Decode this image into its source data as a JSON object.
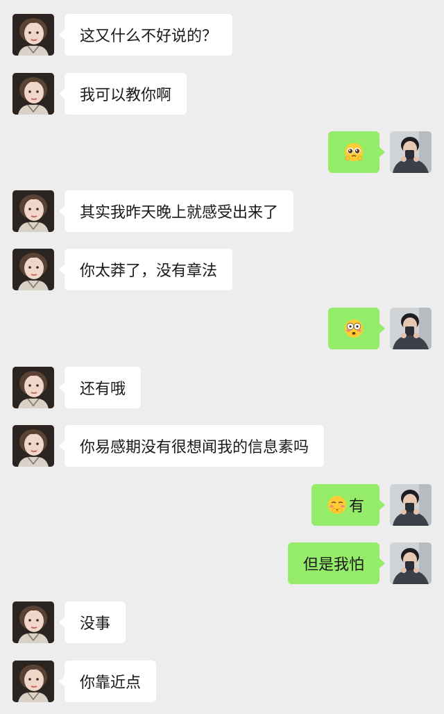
{
  "chat": {
    "colors": {
      "background": "#ededed",
      "incoming_bubble": "#ffffff",
      "outgoing_bubble": "#95ec69",
      "text": "#191919"
    },
    "messages": [
      {
        "side": "left",
        "text": "这又什么不好说的？",
        "avatar": "girl-avatar"
      },
      {
        "side": "left",
        "text": "我可以教你啊",
        "avatar": "girl-avatar"
      },
      {
        "side": "right",
        "text": "",
        "emoji": "pleading-face-emoji",
        "avatar": "boy-avatar"
      },
      {
        "side": "left",
        "text": "其实我昨天晚上就感受出来了",
        "avatar": "girl-avatar"
      },
      {
        "side": "left",
        "text": "你太莽了，没有章法",
        "avatar": "girl-avatar"
      },
      {
        "side": "right",
        "text": "",
        "emoji": "flushed-face-emoji",
        "avatar": "boy-avatar"
      },
      {
        "side": "left",
        "text": "还有哦",
        "avatar": "girl-avatar"
      },
      {
        "side": "left",
        "text": "你易感期没有很想闻我的信息素吗",
        "avatar": "girl-avatar"
      },
      {
        "side": "right",
        "text": "有",
        "emoji": "shy-face-emoji",
        "avatar": "boy-avatar"
      },
      {
        "side": "right",
        "text": "但是我怕",
        "avatar": "boy-avatar"
      },
      {
        "side": "left",
        "text": "没事",
        "avatar": "girl-avatar"
      },
      {
        "side": "left",
        "text": "你靠近点",
        "avatar": "girl-avatar"
      }
    ]
  }
}
